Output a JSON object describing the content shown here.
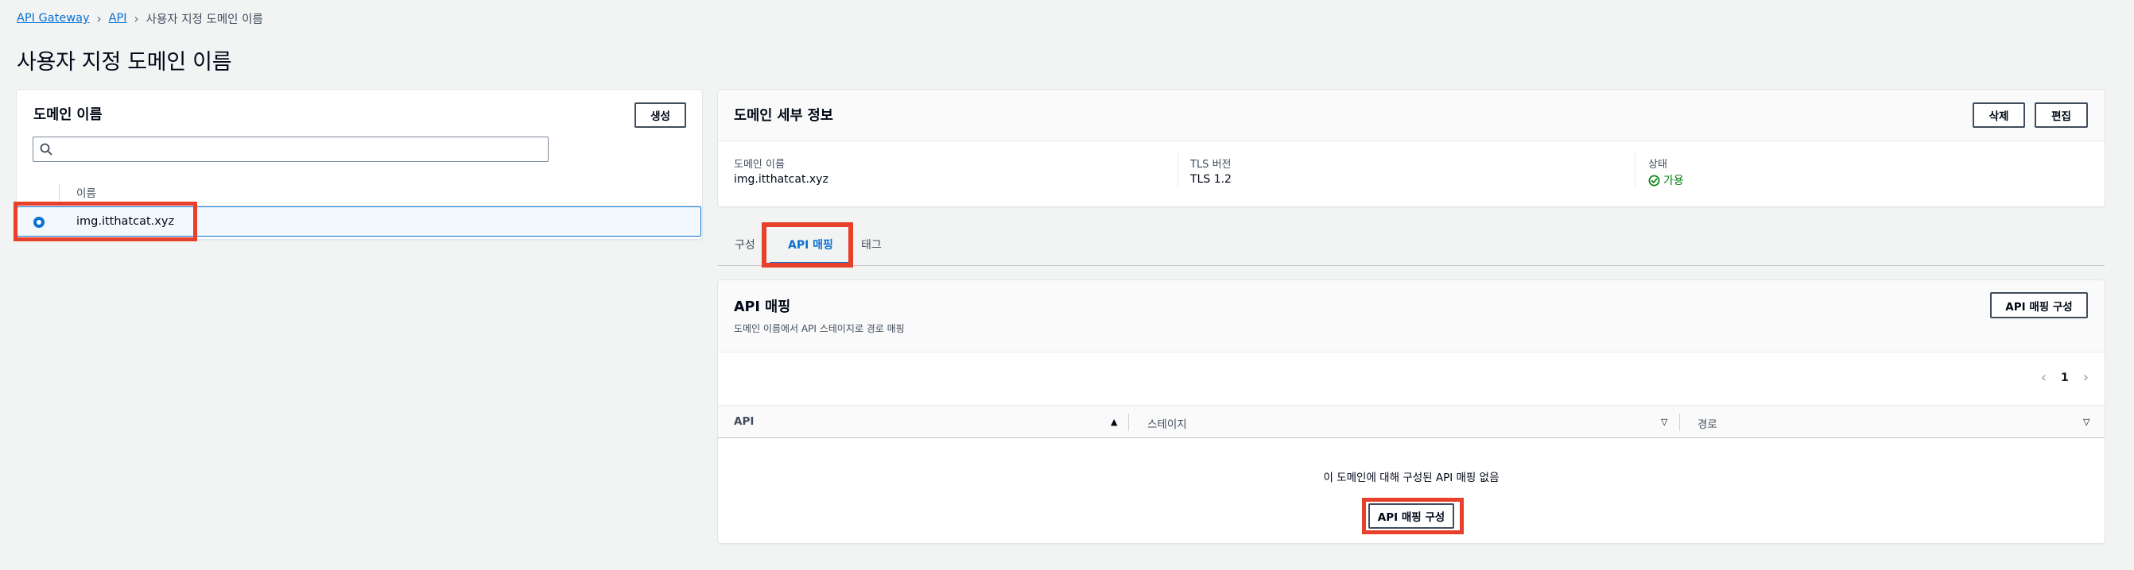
{
  "breadcrumb": {
    "items": [
      "API Gateway",
      "API"
    ],
    "current": "사용자 지정 도메인 이름"
  },
  "page_title": "사용자 지정 도메인 이름",
  "domain_list": {
    "title": "도메인 이름",
    "create_button": "생성",
    "search_placeholder": "",
    "column_name": "이름",
    "rows": [
      {
        "name": "img.itthatcat.xyz",
        "selected": true
      }
    ]
  },
  "details": {
    "title": "도메인 세부 정보",
    "delete_button": "삭제",
    "edit_button": "편집",
    "fields": {
      "domain_label": "도메인 이름",
      "domain_value": "img.itthatcat.xyz",
      "tls_label": "TLS 버전",
      "tls_value": "TLS 1.2",
      "status_label": "상태",
      "status_value": "가용"
    }
  },
  "tabs": [
    {
      "label": "구성",
      "active": false
    },
    {
      "label": "API 매핑",
      "active": true
    },
    {
      "label": "태그",
      "active": false
    }
  ],
  "mappings": {
    "title": "API 매핑",
    "description": "도메인 이름에서 API 스테이지로 경로 매핑",
    "configure_button": "API 매핑 구성",
    "page": "1",
    "columns": [
      "API",
      "스테이지",
      "경로"
    ],
    "empty_message": "이 도메인에 대해 구성된 API 매핑 없음",
    "empty_button": "API 매핑 구성"
  },
  "colors": {
    "link": "#0972d3",
    "highlight": "#e8412b",
    "success": "#037f0c"
  }
}
